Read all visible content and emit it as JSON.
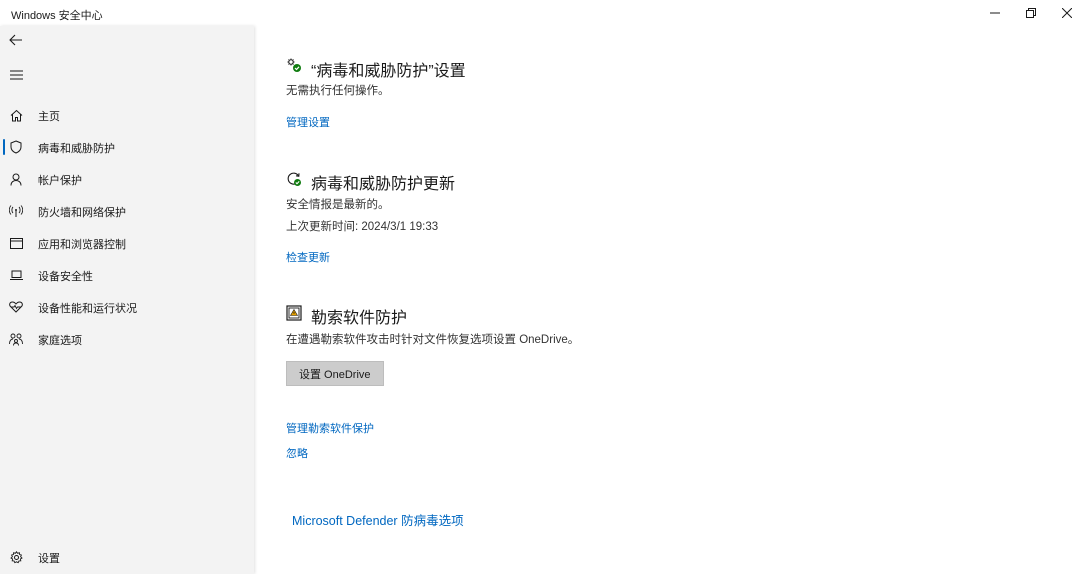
{
  "window": {
    "title": "Windows 安全中心"
  },
  "sidebar": {
    "items": [
      {
        "label": "主页",
        "icon": "home-icon"
      },
      {
        "label": "病毒和威胁防护",
        "icon": "shield-icon",
        "selected": true
      },
      {
        "label": "帐户保护",
        "icon": "person-icon"
      },
      {
        "label": "防火墙和网络保护",
        "icon": "wireless-icon"
      },
      {
        "label": "应用和浏览器控制",
        "icon": "browser-window-icon"
      },
      {
        "label": "设备安全性",
        "icon": "laptop-icon"
      },
      {
        "label": "设备性能和运行状况",
        "icon": "heart-pulse-icon"
      },
      {
        "label": "家庭选项",
        "icon": "family-icon"
      }
    ],
    "settings_label": "设置"
  },
  "main": {
    "settings_section": {
      "title": "“病毒和威胁防护”设置",
      "status": "无需执行任何操作。",
      "link": "管理设置"
    },
    "updates_section": {
      "title": "病毒和威胁防护更新",
      "status": "安全情报是最新的。",
      "last_update": "上次更新时间: 2024/3/1 19:33",
      "link": "检查更新"
    },
    "ransomware_section": {
      "title": "勒索软件防护",
      "description": "在遭遇勒索软件攻击时针对文件恢复选项设置 OneDrive。",
      "button": "设置 OneDrive",
      "manage_link": "管理勒索软件保护",
      "dismiss_link": "忽略"
    },
    "defender_link": "Microsoft Defender 防病毒选项"
  },
  "colors": {
    "accent": "#0067c0",
    "sidebar_bg": "#f3f3f3",
    "status_green": "#107c10",
    "button_gray": "#cccccc"
  }
}
